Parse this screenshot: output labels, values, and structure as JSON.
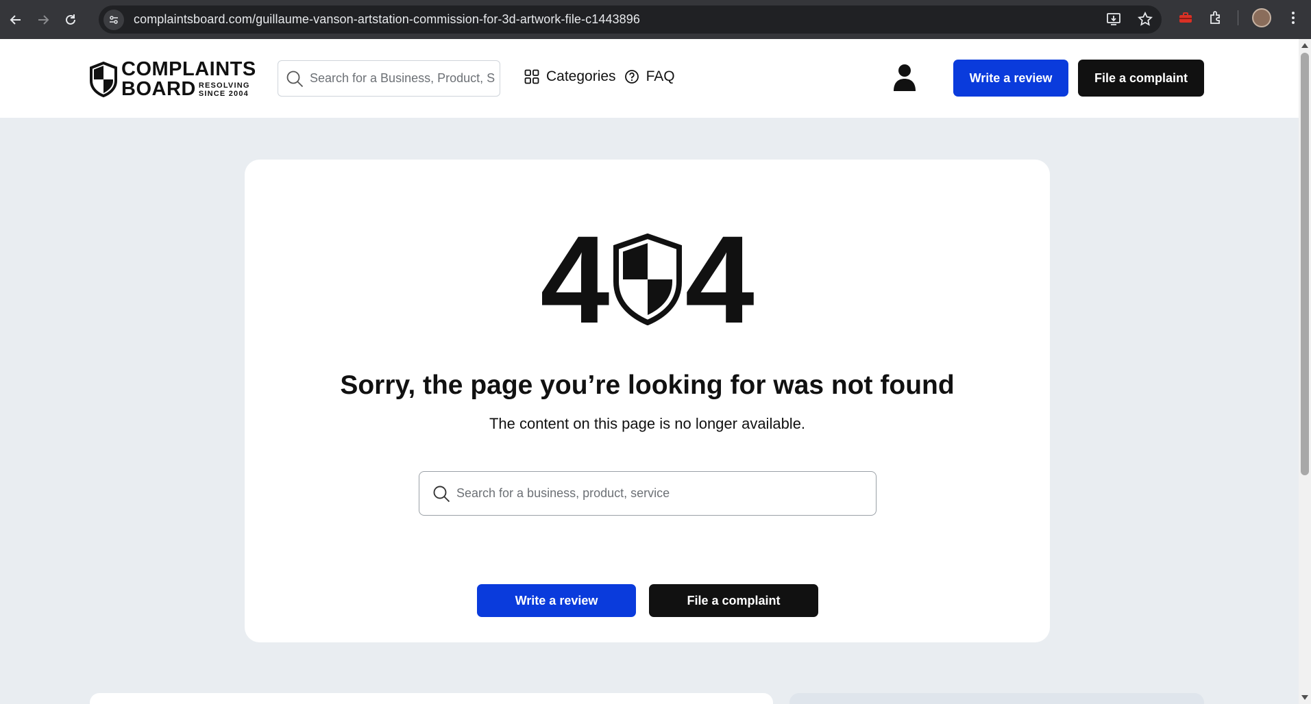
{
  "browser": {
    "url": "complaintsboard.com/guillaume-vanson-artstation-commission-for-3d-artwork-file-c1443896",
    "back_icon": "arrow-left-icon",
    "forward_icon": "arrow-right-icon",
    "reload_icon": "reload-icon"
  },
  "header": {
    "logo": {
      "line1": "COMPLAINTS",
      "line2": "BOARD",
      "tag1": "RESOLVING",
      "tag2": "SINCE 2004"
    },
    "search_placeholder": "Search for a Business, Product, Service",
    "nav": [
      {
        "label": "Categories",
        "icon": "grid-icon"
      },
      {
        "label": "FAQ",
        "icon": "question-circle-icon"
      }
    ],
    "write_review": "Write a review",
    "file_complaint": "File a complaint"
  },
  "error": {
    "code_left": "4",
    "code_right": "4",
    "title": "Sorry, the page you’re looking for was not found",
    "subtitle": "The content on this page is no longer available.",
    "search_placeholder": "Search for a business, product, service",
    "write_review": "Write a review",
    "file_complaint": "File a complaint"
  },
  "colors": {
    "primary_blue": "#0a3bdc",
    "black": "#111111",
    "page_bg": "#e9edf1"
  }
}
